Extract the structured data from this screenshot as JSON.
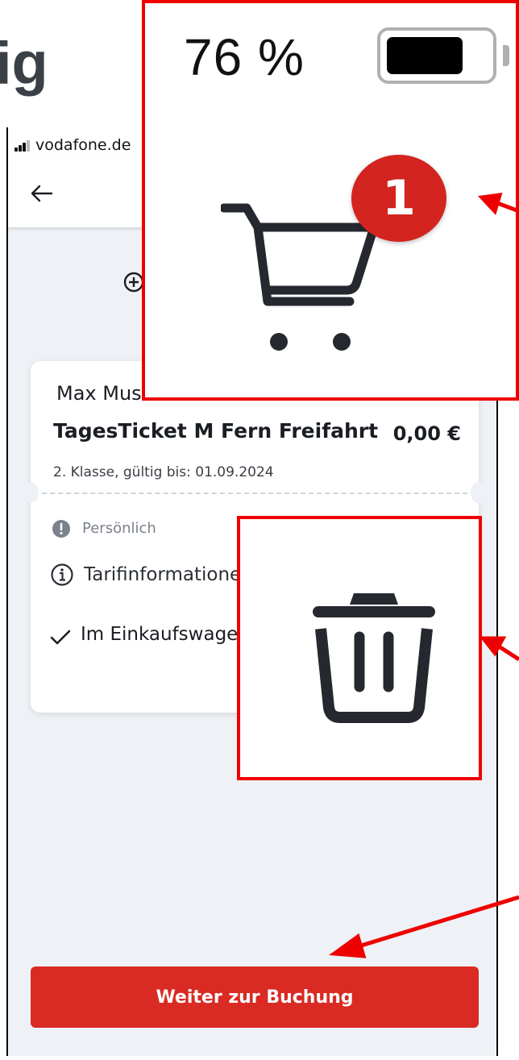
{
  "slide": {
    "title_fragment": "ig"
  },
  "statusbar": {
    "carrier": "vodafone.de",
    "battery_percent": "76 %",
    "battery_level": 0.76
  },
  "cart": {
    "badge_count": "1"
  },
  "card": {
    "passenger": "Max Mus",
    "ticket_name": "TagesTicket M Fern Freifahrt",
    "price": "0,00 €",
    "validity": "2. Klasse, gültig bis: 01.09.2024",
    "personal_label": "Persönlich",
    "tariff_label": "Tarifinformatione",
    "in_cart_label": "Im Einkaufswagen"
  },
  "cta": {
    "label": "Weiter zur Buchung"
  },
  "colors": {
    "accent_red": "#d92a23",
    "highlight_red": "#ee0000",
    "background": "#eef1f5"
  },
  "icons": [
    "signal-icon",
    "back-arrow-icon",
    "add-circle-icon",
    "exclamation-icon",
    "info-icon",
    "checkmark-icon",
    "shopping-cart-icon",
    "trash-icon"
  ]
}
